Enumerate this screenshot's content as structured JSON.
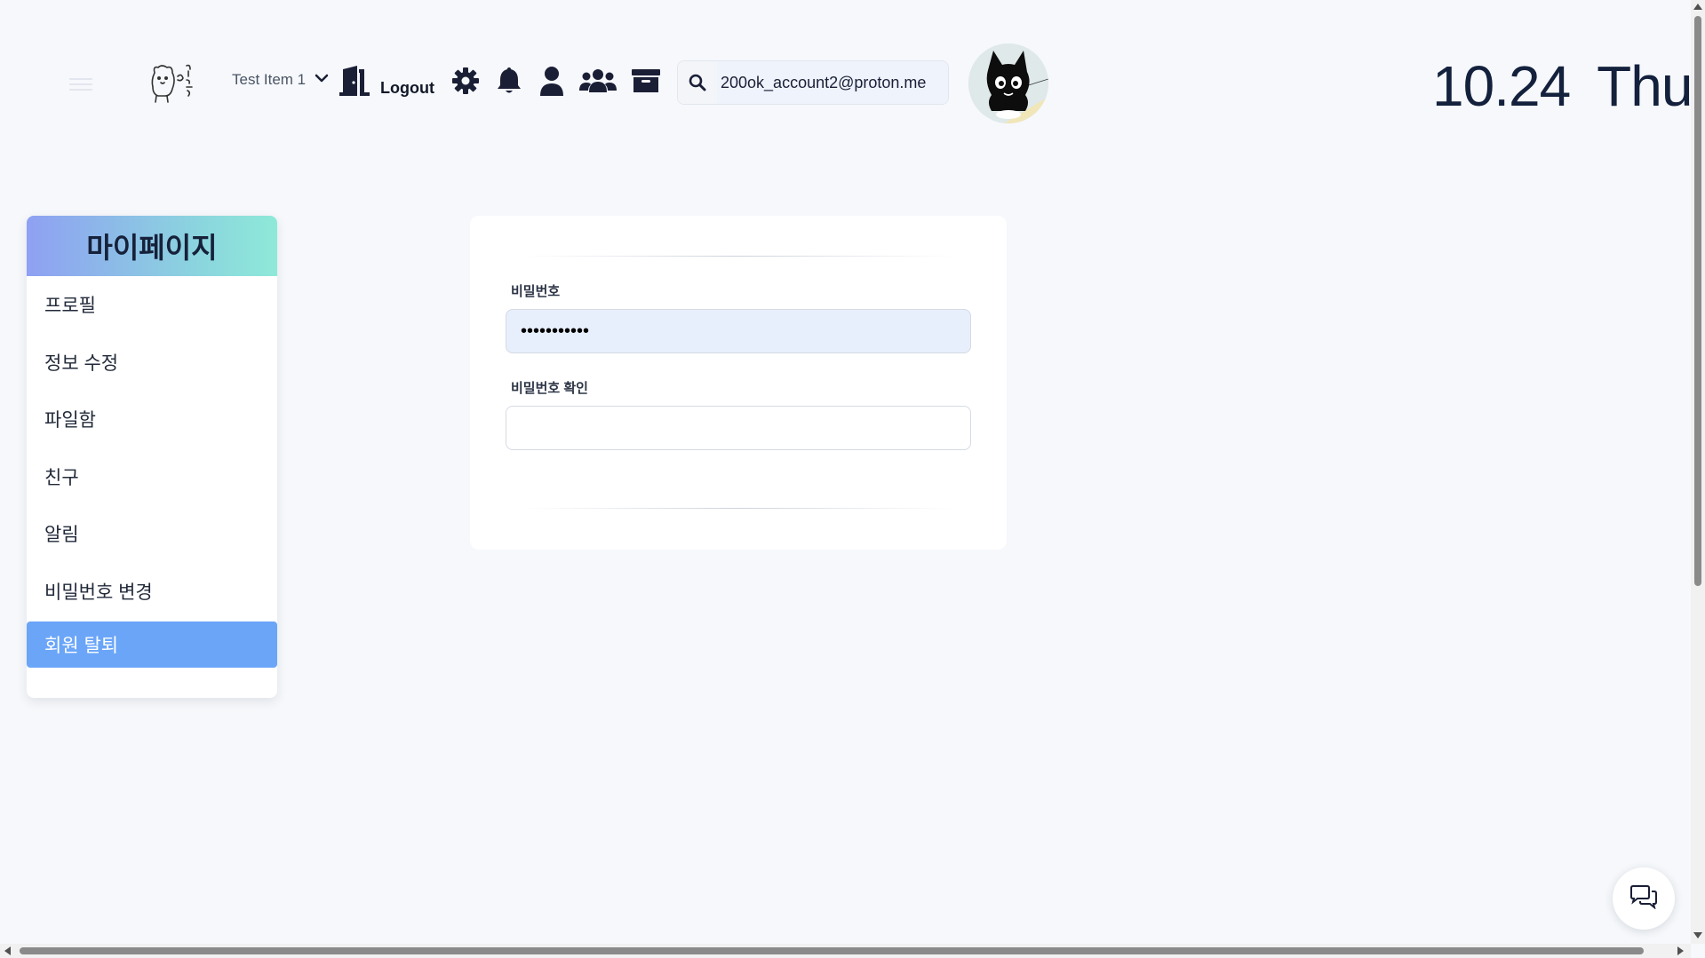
{
  "header": {
    "menu_icon": "hamburger-icon",
    "logo_icon": "bear-doodle-logo",
    "item_select": {
      "label": "Test Item 1",
      "icon": "chevron-down-icon"
    },
    "logout": {
      "label": "Logout",
      "icon": "door-exit-icon"
    },
    "icons": [
      "gear-icon",
      "bell-icon",
      "user-icon",
      "users-icon",
      "archive-icon"
    ],
    "search": {
      "value": "200ok_account2@proton.me",
      "icon": "search-icon"
    },
    "avatar": "black-cat-avatar",
    "date": {
      "day": "10.24",
      "weekday": "Thu"
    }
  },
  "sidebar": {
    "title": "마이페이지",
    "items": [
      {
        "label": "프로필"
      },
      {
        "label": "정보 수정"
      },
      {
        "label": "파일함"
      },
      {
        "label": "친구"
      },
      {
        "label": "알림"
      },
      {
        "label": "비밀번호 변경"
      },
      {
        "label": "회원 탈퇴",
        "active": true
      }
    ]
  },
  "form": {
    "password_label": "비밀번호",
    "password_value": "•••••••••••",
    "confirm_label": "비밀번호 확인",
    "confirm_value": ""
  },
  "chat_button": {
    "icon": "chat-bubbles-icon"
  },
  "colors": {
    "accent": "#6aa5f8",
    "background": "#f6f8fb",
    "text": "#14213d"
  }
}
